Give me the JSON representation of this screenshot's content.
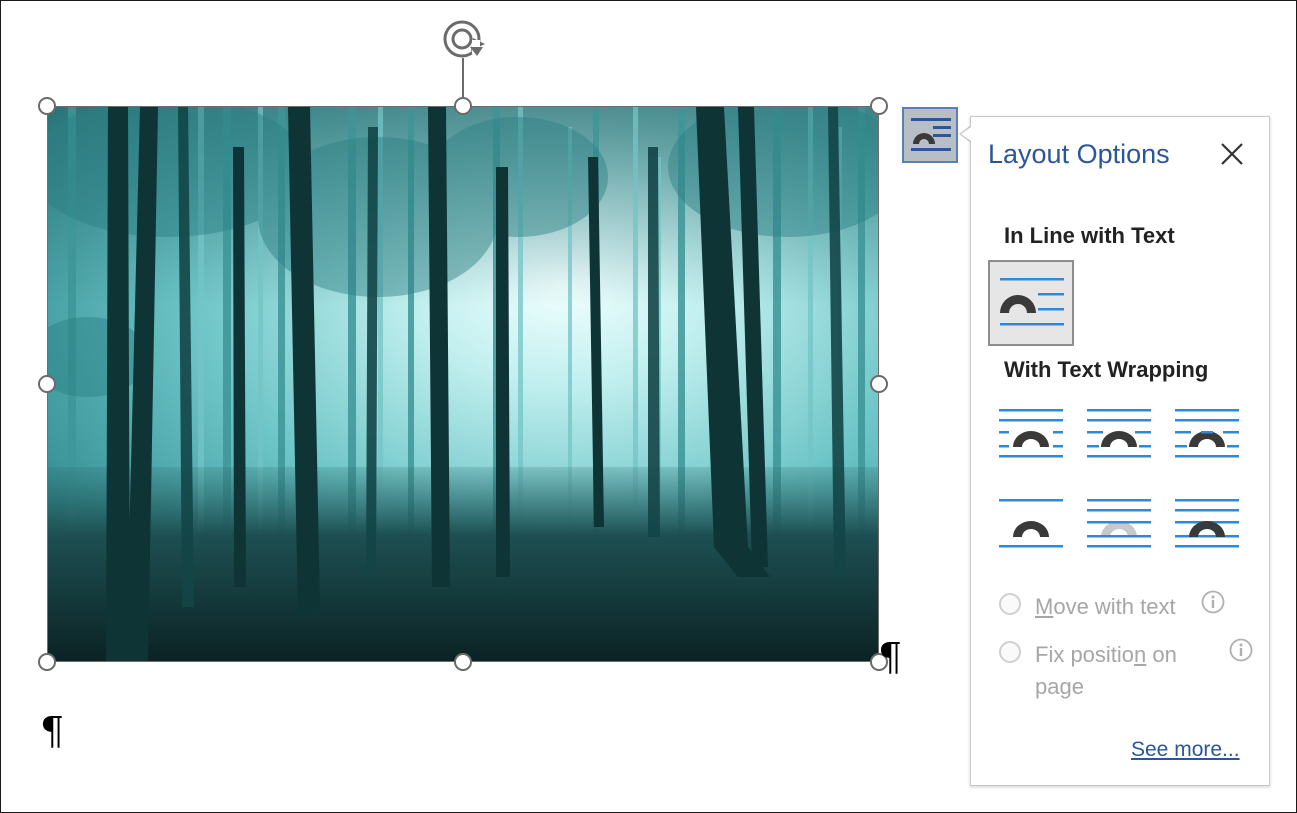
{
  "document": {
    "paragraph_mark": "¶"
  },
  "layout_options": {
    "title": "Layout Options",
    "close_icon": "close-icon",
    "section_inline": "In Line with Text",
    "section_wrapping": "With Text Wrapping",
    "inline_options": [
      {
        "name": "In Line with Text",
        "icon": "wrap-inline-icon",
        "selected": true
      }
    ],
    "wrapping_options": [
      {
        "name": "Square",
        "icon": "wrap-square-icon"
      },
      {
        "name": "Tight",
        "icon": "wrap-tight-icon"
      },
      {
        "name": "Through",
        "icon": "wrap-through-icon"
      },
      {
        "name": "Top and Bottom",
        "icon": "wrap-top-bottom-icon"
      },
      {
        "name": "Behind Text",
        "icon": "wrap-behind-text-icon"
      },
      {
        "name": "In Front of Text",
        "icon": "wrap-in-front-icon"
      }
    ],
    "move_with_text": {
      "label_pre": "",
      "label_u": "M",
      "label_post": "ove with text",
      "enabled": false
    },
    "fix_position": {
      "label_pre": "Fix positio",
      "label_u": "n",
      "label_post": " on",
      "label_line2": "page",
      "enabled": false
    },
    "see_more": "See more...",
    "colors": {
      "accent": "#2b579a",
      "line": "#2e8ad8",
      "shape": "#3a3a3a",
      "disabled": "#a6a6a6"
    }
  }
}
